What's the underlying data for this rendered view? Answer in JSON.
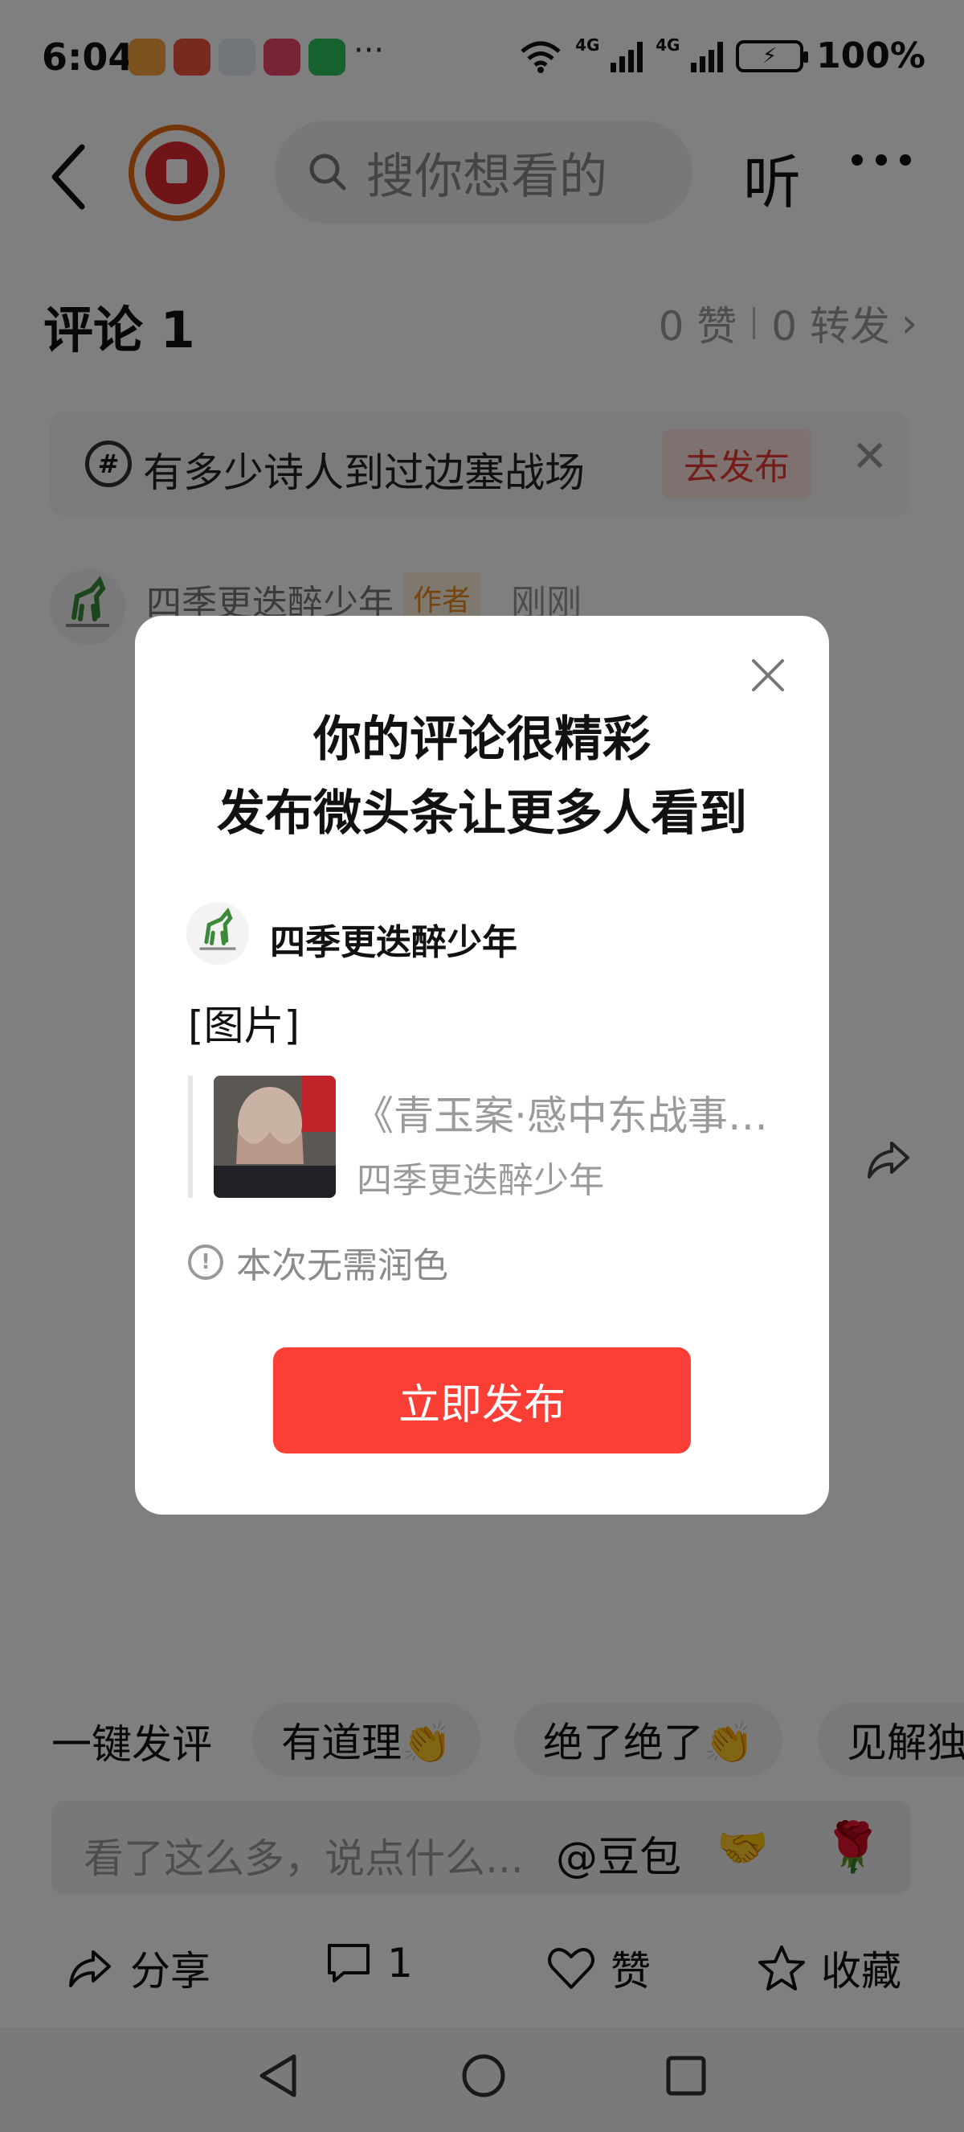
{
  "status_bar": {
    "time": "6:04",
    "network_1": "4G",
    "network_2": "4G",
    "battery": "100%",
    "more": "···"
  },
  "header": {
    "search_placeholder": "搜你想看的",
    "listen_label": "听"
  },
  "comments": {
    "title": "评论 1",
    "likes": "0 赞",
    "reposts": "0 转发",
    "chevron": "›"
  },
  "topic": {
    "hash": "#",
    "text": "有多少诗人到过边塞战场",
    "post_label": "去发布",
    "close": "✕"
  },
  "comment": {
    "author": "四季更迭醉少年",
    "badge": "作者",
    "time": "刚刚"
  },
  "modal": {
    "title_line1": "你的评论很精彩",
    "title_line2": "发布微头条让更多人看到",
    "author": "四季更迭醉少年",
    "content": "[图片]",
    "quote_title": "《青玉案·感中东战事…",
    "quote_author": "四季更迭醉少年",
    "hint": "本次无需润色",
    "hint_icon": "!",
    "publish_label": "立即发布"
  },
  "quick_reply": {
    "label": "一键发评",
    "chips": [
      "有道理👏",
      "绝了绝了👏",
      "见解独"
    ]
  },
  "input": {
    "placeholder": "看了这么多，说点什么...",
    "mention": "@豆包",
    "emoji_1": "🤝",
    "emoji_2": "🌹"
  },
  "actions": {
    "share": "分享",
    "comment_count": "1",
    "like": "赞",
    "favorite": "收藏"
  },
  "colors": {
    "accent_red": "#fb3e36",
    "author_badge": "#e98b1e",
    "overlay": "rgba(0,0,0,0.5)"
  }
}
